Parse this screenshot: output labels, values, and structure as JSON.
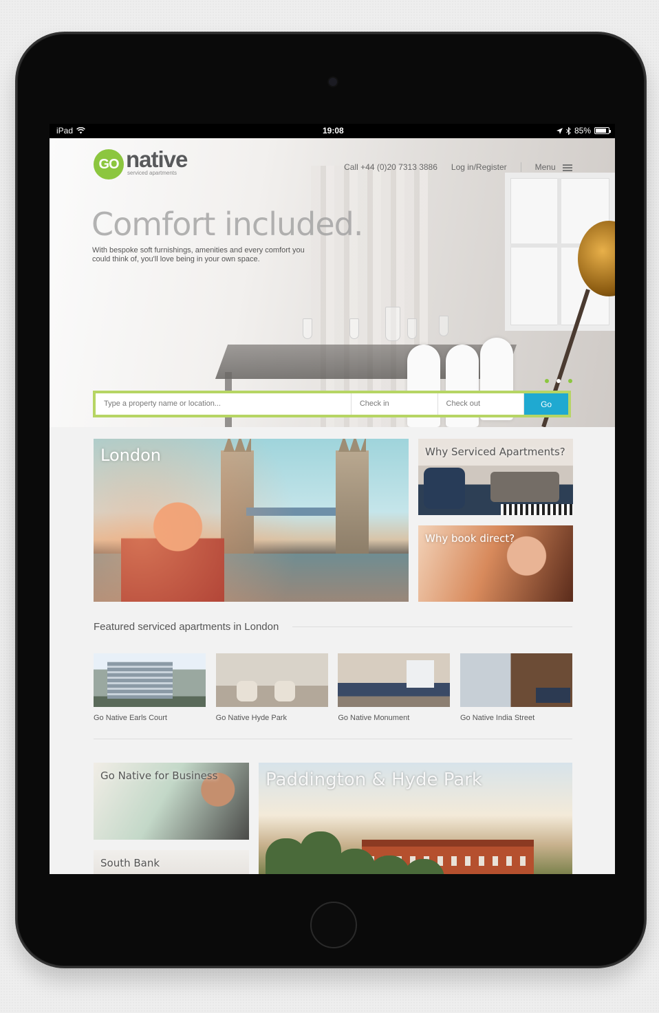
{
  "status_bar": {
    "device": "iPad",
    "time": "19:08",
    "battery": "85%",
    "battery_level": 0.85
  },
  "brand": {
    "logo_go": "GO",
    "logo_name": "native",
    "logo_tagline": "serviced apartments",
    "accent_color": "#8cc63f",
    "button_color": "#1fa9d1"
  },
  "nav": {
    "phone": "Call +44 (0)20 7313 3886",
    "login": "Log in/Register",
    "menu": "Menu",
    "menu_icon": "hamburger-icon"
  },
  "hero": {
    "title": "Comfort included.",
    "subtitle": "With bespoke soft furnishings, amenities and every comfort you could think of, you'll love being in your own space.",
    "slides_total": 3,
    "active_slide": 3
  },
  "search": {
    "placeholder": "Type a property name or location...",
    "checkin_placeholder": "Check in",
    "checkout_placeholder": "Check out",
    "go_label": "Go"
  },
  "tiles": {
    "london": "London",
    "why_serviced": "Why Serviced Apartments?",
    "why_direct": "Why book direct?",
    "business": "Go Native for Business",
    "south_bank": "South Bank",
    "paddington": "Paddington & Hyde Park"
  },
  "featured": {
    "title": "Featured serviced apartments in London",
    "properties": [
      {
        "name": "Go Native Earls Court"
      },
      {
        "name": "Go Native Hyde Park"
      },
      {
        "name": "Go Native Monument"
      },
      {
        "name": "Go Native India Street"
      }
    ]
  }
}
